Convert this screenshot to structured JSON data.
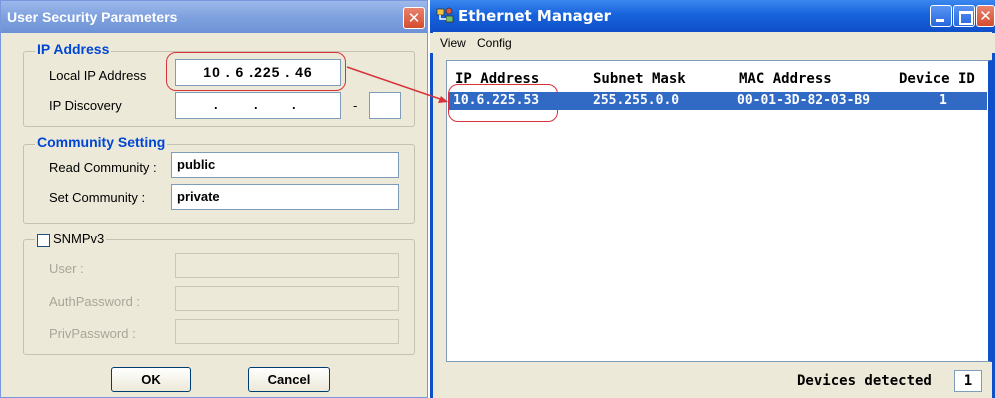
{
  "dialog": {
    "title": "User Security Parameters",
    "close_label": "✕",
    "ip_group": {
      "legend": "IP Address",
      "local_ip_label": "Local IP Address",
      "local_ip_value": "10  .  6  .225  . 46",
      "discovery_label": "IP Discovery",
      "discovery_dash": "-"
    },
    "community_group": {
      "legend": "Community Setting",
      "read_label": "Read Community :",
      "read_value": "public",
      "set_label": "Set Community :",
      "set_value": "private"
    },
    "snmp_group": {
      "legend": "SNMPv3",
      "checked": false,
      "user_label": "User :",
      "auth_label": "AuthPassword :",
      "priv_label": "PrivPassword :"
    },
    "ok_label": "OK",
    "cancel_label": "Cancel"
  },
  "manager": {
    "title": "Ethernet Manager",
    "menu": [
      "View",
      "Config"
    ],
    "columns": [
      "IP Address",
      "Subnet Mask",
      "MAC Address",
      "Device ID"
    ],
    "rows": [
      {
        "ip": "10.6.225.53",
        "mask": "255.255.0.0",
        "mac": "00-01-3D-82-03-B9",
        "id": "1"
      }
    ],
    "status_label": "Devices detected",
    "status_count": "1"
  },
  "colors": {
    "annotation": "#d8323a",
    "selection": "#316ac5",
    "xp_blue": "#0f4fc8"
  },
  "icons": [
    "close-icon",
    "ethernet-manager-icon",
    "minimize-icon",
    "maximize-icon",
    "checkbox-icon"
  ]
}
